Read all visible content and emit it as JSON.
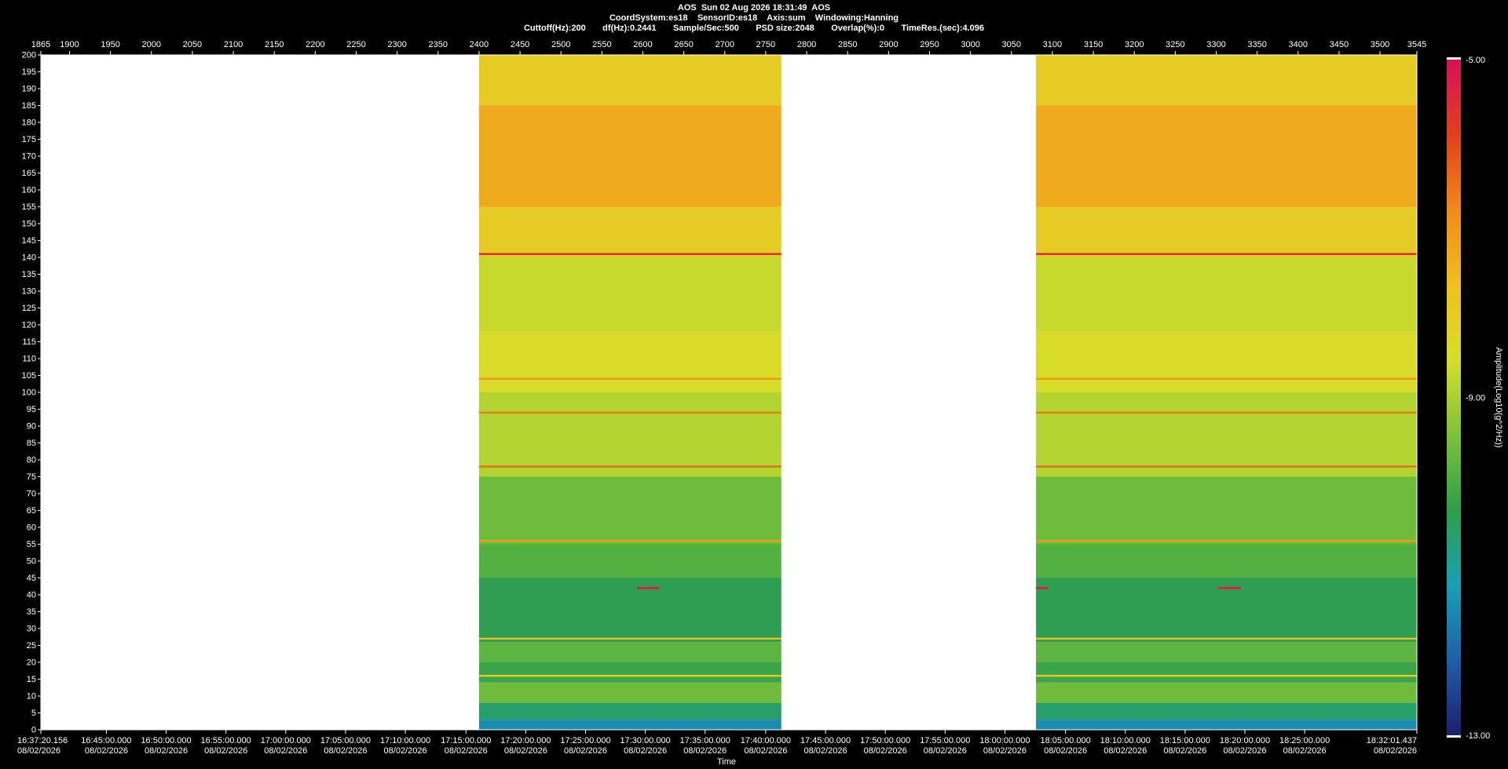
{
  "header": {
    "line1": "AOS  Sun 02 Aug 2026 18:31:49  AOS",
    "line2": "CoordSystem:es18    SensorID:es18    Axis:sum    Windowing:Hanning",
    "line3": "Cuttoff(Hz):200       df(Hz):0.2441       Sample/Sec:500       PSD size:2048       Overlap(%):0       TimeRes.(sec):4.096"
  },
  "chart_data": {
    "type": "heatmap",
    "title": "AOS  Sun 02 Aug 2026 18:31:49  AOS",
    "xlabel": "Time",
    "ylabel": "",
    "colorbar_label": "Amplitude(Log10(g^2/Hz))",
    "colorbar_ticks": [
      "-5.00",
      "-9.00",
      "-13.00"
    ],
    "colorbar_range": [
      -13,
      -5
    ],
    "ylim": [
      0,
      200
    ],
    "y_ticks": [
      0,
      5,
      10,
      15,
      20,
      25,
      30,
      35,
      40,
      45,
      50,
      55,
      60,
      65,
      70,
      75,
      80,
      85,
      90,
      95,
      100,
      105,
      110,
      115,
      120,
      125,
      130,
      135,
      140,
      145,
      150,
      155,
      160,
      165,
      170,
      175,
      180,
      185,
      190,
      195,
      200
    ],
    "x_index_range": [
      1865,
      3545
    ],
    "x_index_ticks": [
      "1865",
      "1900",
      "1950",
      "2000",
      "2050",
      "2100",
      "2150",
      "2200",
      "2250",
      "2300",
      "2350",
      "2400",
      "2450",
      "2500",
      "2550",
      "2600",
      "2650",
      "2700",
      "2750",
      "2800",
      "2850",
      "2900",
      "2950",
      "3000",
      "3050",
      "3100",
      "3150",
      "3200",
      "3250",
      "3300",
      "3350",
      "3400",
      "3450",
      "3500",
      "3545"
    ],
    "time_ticks": [
      {
        "index": 1865,
        "time": "16:37:20.156",
        "date": "08/02/2026"
      },
      {
        "index": 1945,
        "time": "16:45:00.000",
        "date": "08/02/2026"
      },
      {
        "index": 2018,
        "time": "16:50:00.000",
        "date": "08/02/2026"
      },
      {
        "index": 2091,
        "time": "16:55:00.000",
        "date": "08/02/2026"
      },
      {
        "index": 2164,
        "time": "17:00:00.000",
        "date": "08/02/2026"
      },
      {
        "index": 2237,
        "time": "17:05:00.000",
        "date": "08/02/2026"
      },
      {
        "index": 2310,
        "time": "17:10:00.000",
        "date": "08/02/2026"
      },
      {
        "index": 2384,
        "time": "17:15:00.000",
        "date": "08/02/2026"
      },
      {
        "index": 2457,
        "time": "17:20:00.000",
        "date": "08/02/2026"
      },
      {
        "index": 2530,
        "time": "17:25:00.000",
        "date": "08/02/2026"
      },
      {
        "index": 2603,
        "time": "17:30:00.000",
        "date": "08/02/2026"
      },
      {
        "index": 2676,
        "time": "17:35:00.000",
        "date": "08/02/2026"
      },
      {
        "index": 2750,
        "time": "17:40:00.000",
        "date": "08/02/2026"
      },
      {
        "index": 2823,
        "time": "17:45:00.000",
        "date": "08/02/2026"
      },
      {
        "index": 2896,
        "time": "17:50:00.000",
        "date": "08/02/2026"
      },
      {
        "index": 2969,
        "time": "17:55:00.000",
        "date": "08/02/2026"
      },
      {
        "index": 3042,
        "time": "18:00:00.000",
        "date": "08/02/2026"
      },
      {
        "index": 3116,
        "time": "18:05:00.000",
        "date": "08/02/2026"
      },
      {
        "index": 3189,
        "time": "18:10:00.000",
        "date": "08/02/2026"
      },
      {
        "index": 3262,
        "time": "18:15:00.000",
        "date": "08/02/2026"
      },
      {
        "index": 3335,
        "time": "18:20:00.000",
        "date": "08/02/2026"
      },
      {
        "index": 3408,
        "time": "18:25:00.000",
        "date": "08/02/2026"
      },
      {
        "index": 3545,
        "time": "18:32:01.437",
        "date": "08/02/2026"
      }
    ],
    "data_segments": [
      {
        "x_start": 2400,
        "x_end": 2769
      },
      {
        "x_start": 3080,
        "x_end": 3545
      }
    ],
    "frequency_bands": [
      {
        "f_from": 0,
        "f_to": 3,
        "level": -11.5
      },
      {
        "f_from": 3,
        "f_to": 8,
        "level": -10.6
      },
      {
        "f_from": 8,
        "f_to": 14,
        "level": -9.6
      },
      {
        "f_from": 14,
        "f_to": 20,
        "level": -10.2
      },
      {
        "f_from": 20,
        "f_to": 26,
        "level": -9.8
      },
      {
        "f_from": 26,
        "f_to": 45,
        "level": -10.4
      },
      {
        "f_from": 45,
        "f_to": 55,
        "level": -9.9
      },
      {
        "f_from": 55,
        "f_to": 75,
        "level": -9.6
      },
      {
        "f_from": 75,
        "f_to": 100,
        "level": -8.9
      },
      {
        "f_from": 100,
        "f_to": 118,
        "level": -8.5
      },
      {
        "f_from": 118,
        "f_to": 140,
        "level": -8.7
      },
      {
        "f_from": 140,
        "f_to": 155,
        "level": -8.0
      },
      {
        "f_from": 155,
        "f_to": 185,
        "level": -7.3
      },
      {
        "f_from": 185,
        "f_to": 200,
        "level": -8.0
      }
    ],
    "tonal_lines": [
      {
        "freq": 141,
        "level": -5.4
      },
      {
        "freq": 104,
        "level": -7.0
      },
      {
        "freq": 94,
        "level": -6.6
      },
      {
        "freq": 78,
        "level": -6.4
      },
      {
        "freq": 56,
        "level": -7.0
      },
      {
        "freq": 27,
        "level": -7.6
      },
      {
        "freq": 16,
        "level": -7.9
      }
    ],
    "short_events": [
      {
        "x_start": 2593,
        "x_end": 2620,
        "freq": 42,
        "level": -5.3
      },
      {
        "x_start": 3080,
        "x_end": 3095,
        "freq": 42,
        "level": -5.3
      },
      {
        "x_start": 3302,
        "x_end": 3330,
        "freq": 42,
        "level": -5.3
      }
    ],
    "grid": false,
    "colors": {
      "background": "#000000",
      "empty_region": "#ffffff",
      "colormap": [
        "#1b1f6e",
        "#1e5fa8",
        "#19a0b4",
        "#2f9e4a",
        "#7cc23a",
        "#d6de2a",
        "#f0c020",
        "#f08a1a",
        "#e0401e",
        "#d5105a"
      ]
    }
  }
}
